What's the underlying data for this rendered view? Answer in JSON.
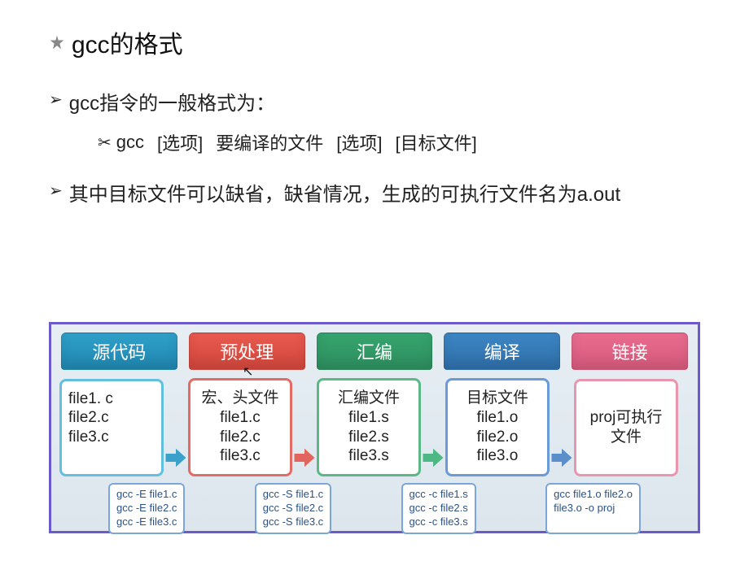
{
  "title": "gcc的格式",
  "bullets": {
    "b1": "gcc指令的一般格式为：",
    "b2": "其中目标文件可以缺省，缺省情况，生成的可执行文件名为a.out"
  },
  "command": {
    "cmd": "gcc",
    "opt1": "[选项]",
    "src": "要编译的文件",
    "opt2": "[选项]",
    "tgt": "[目标文件]"
  },
  "diagram": {
    "tabs": {
      "t1": "源代码",
      "t2": "预处理",
      "t3": "汇编",
      "t4": "编译",
      "t5": "链接"
    },
    "cards": {
      "c1": "file1. c\nfile2.c\nfile3.c",
      "c2_top": "宏、头文件",
      "c2": "file1.c\nfile2.c\nfile3.c",
      "c3_top": "汇编文件",
      "c3": "file1.s\nfile2.s\nfile3.s",
      "c4_top": "目标文件",
      "c4": "file1.o\nfile2.o\nfile3.o",
      "c5": "proj可执行文件"
    },
    "cmds": {
      "cmd1": "gcc -E file1.c\ngcc -E file2.c\ngcc -E file3.c",
      "cmd2": "gcc -S file1.c\ngcc -S file2.c\ngcc -S file3.c",
      "cmd3": "gcc -c file1.s\ngcc -c file2.s\ngcc -c file3.s",
      "cmd4": "gcc file1.o file2.o\nfile3.o -o proj"
    }
  }
}
